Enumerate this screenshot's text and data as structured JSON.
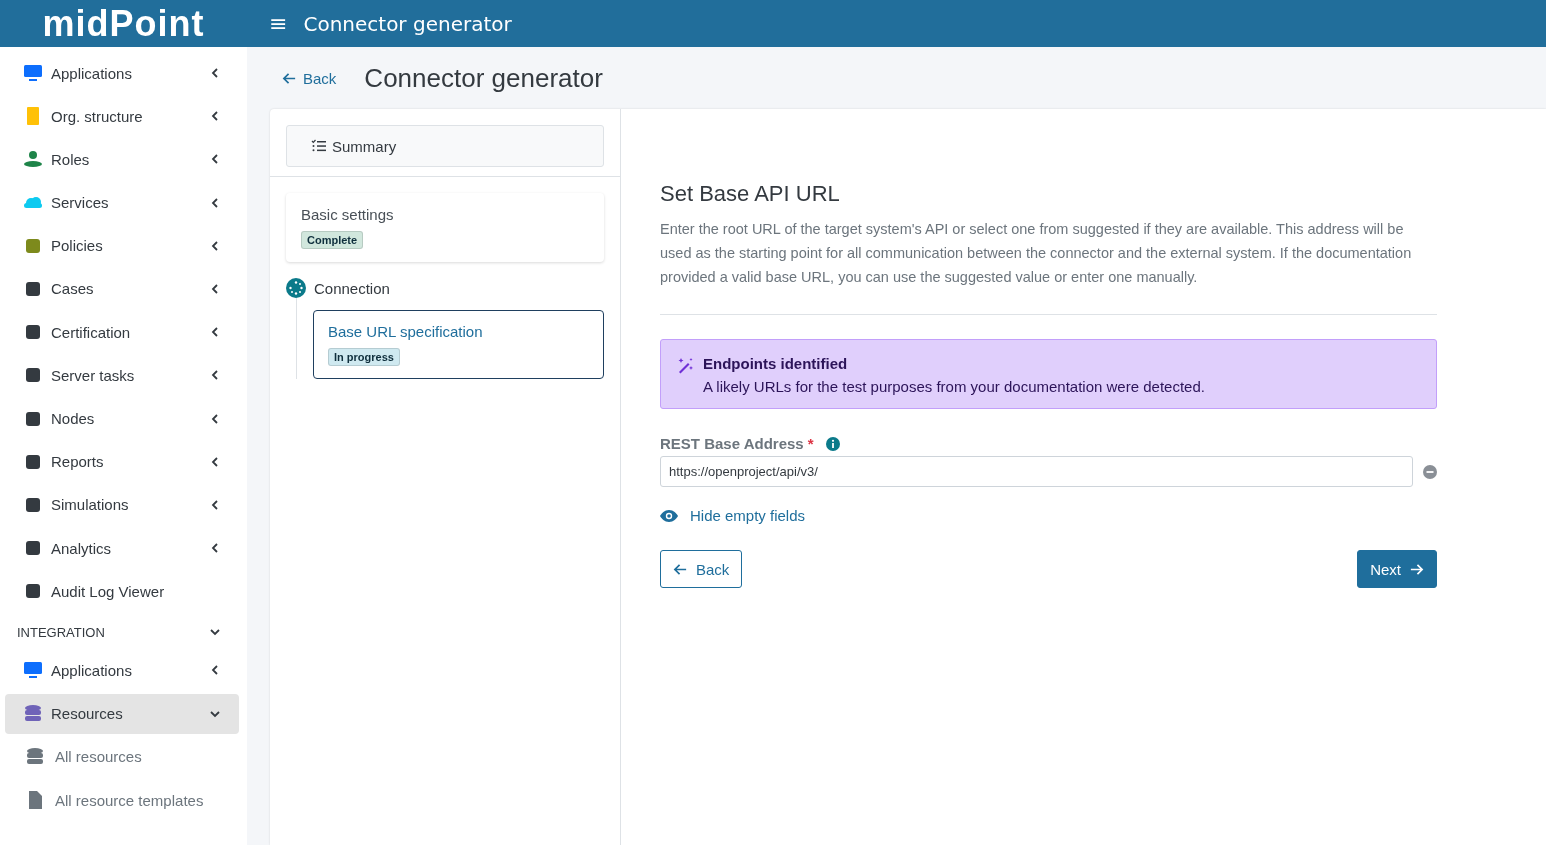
{
  "header": {
    "logo": "midPoint",
    "menu_icon": "≡",
    "title": "Connector generator"
  },
  "sidebar": {
    "items": [
      {
        "label": "Applications",
        "kind": "item",
        "expanded": false,
        "selected": false
      },
      {
        "label": "Org. structure",
        "kind": "item",
        "expanded": false,
        "selected": false
      },
      {
        "label": "Roles",
        "kind": "item",
        "expanded": false,
        "selected": false
      },
      {
        "label": "Services",
        "kind": "item",
        "expanded": false,
        "selected": false
      },
      {
        "label": "Policies",
        "kind": "item",
        "expanded": false,
        "selected": false
      },
      {
        "label": "Cases",
        "kind": "item",
        "expanded": false,
        "selected": false
      },
      {
        "label": "Certification",
        "kind": "item",
        "expanded": false,
        "selected": false
      },
      {
        "label": "Server tasks",
        "kind": "item",
        "expanded": false,
        "selected": false
      },
      {
        "label": "Nodes",
        "kind": "item",
        "expanded": false,
        "selected": false
      },
      {
        "label": "Reports",
        "kind": "item",
        "expanded": false,
        "selected": false
      },
      {
        "label": "Simulations",
        "kind": "item",
        "expanded": false,
        "selected": false
      },
      {
        "label": "Analytics",
        "kind": "item",
        "expanded": false,
        "selected": false
      },
      {
        "label": "Audit Log Viewer",
        "kind": "link",
        "selected": false
      },
      {
        "label": "INTEGRATION",
        "kind": "section",
        "expanded": true
      },
      {
        "label": "Applications",
        "kind": "item",
        "expanded": false,
        "selected": false
      },
      {
        "label": "Resources",
        "kind": "item",
        "expanded": true,
        "selected": true,
        "children": [
          {
            "label": "All resources",
            "selected": false
          },
          {
            "label": "All resource templates",
            "selected": false
          }
        ]
      }
    ]
  },
  "page": {
    "back": "Back",
    "title": "Connector generator"
  },
  "steps": {
    "summary": "Summary",
    "items": [
      {
        "label": "Basic settings",
        "kind": "card",
        "status": "Complete",
        "color": "#d1e7dd",
        "selected": false
      },
      {
        "label": "Connection",
        "kind": "group",
        "children": [
          {
            "label": "Base URL specification",
            "status": "In progress",
            "color": "#cfe9f0",
            "selected": true
          }
        ]
      }
    ]
  },
  "form": {
    "title": "Set Base API URL",
    "description": "Enter the root URL of the target system's API or select one from suggested if they are available. This address will be used as the starting point for all communication between the connector and the external system. If the documentation provided a valid base URL, you can use the suggested value or enter one manually.",
    "alert": {
      "title": "Endpoints identified",
      "text": "A likely URLs for the test purposes from your documentation were detected."
    },
    "field": {
      "label": "REST Base Address",
      "required": "*",
      "value": "https://openproject/api/v3/"
    },
    "toggle": "Hide empty fields",
    "back": "Back",
    "next": "Next"
  }
}
